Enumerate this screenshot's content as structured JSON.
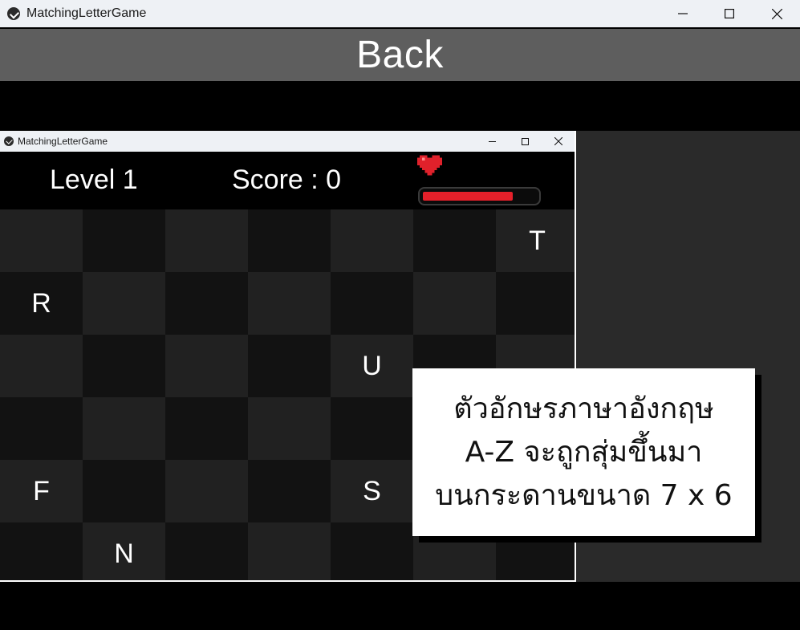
{
  "window": {
    "title": "MatchingLetterGame",
    "icon": "app-logo-icon",
    "controls": [
      "minimize-icon",
      "maximize-icon",
      "close-icon"
    ]
  },
  "back_button": {
    "label": "Back"
  },
  "game_window": {
    "title": "MatchingLetterGame",
    "icon": "app-logo-icon",
    "controls": [
      "minimize-icon",
      "maximize-icon",
      "close-icon"
    ]
  },
  "hud": {
    "level": "Level 1",
    "score": "Score : 0",
    "heart_icon": "heart-icon",
    "health_fraction": 0.77,
    "health_color": "#e5202a"
  },
  "board": {
    "columns": 7,
    "rows": 6,
    "cells": [
      [
        "",
        "",
        "",
        "",
        "",
        "",
        "T"
      ],
      [
        "R",
        "",
        "",
        "",
        "",
        "",
        ""
      ],
      [
        "",
        "",
        "",
        "",
        "U",
        "",
        ""
      ],
      [
        "",
        "",
        "",
        "",
        "",
        "",
        ""
      ],
      [
        "F",
        "",
        "",
        "",
        "S",
        "",
        ""
      ],
      [
        "",
        "N",
        "",
        "",
        "",
        "",
        ""
      ]
    ],
    "colors": {
      "light": "#212121",
      "dark": "#121212"
    }
  },
  "overlay_card": {
    "lines": [
      "ตัวอักษรภาษาอังกฤษ",
      "A-Z จะถูกสุ่มขึ้นมา",
      "บนกระดานขนาด 7 x 6"
    ]
  }
}
